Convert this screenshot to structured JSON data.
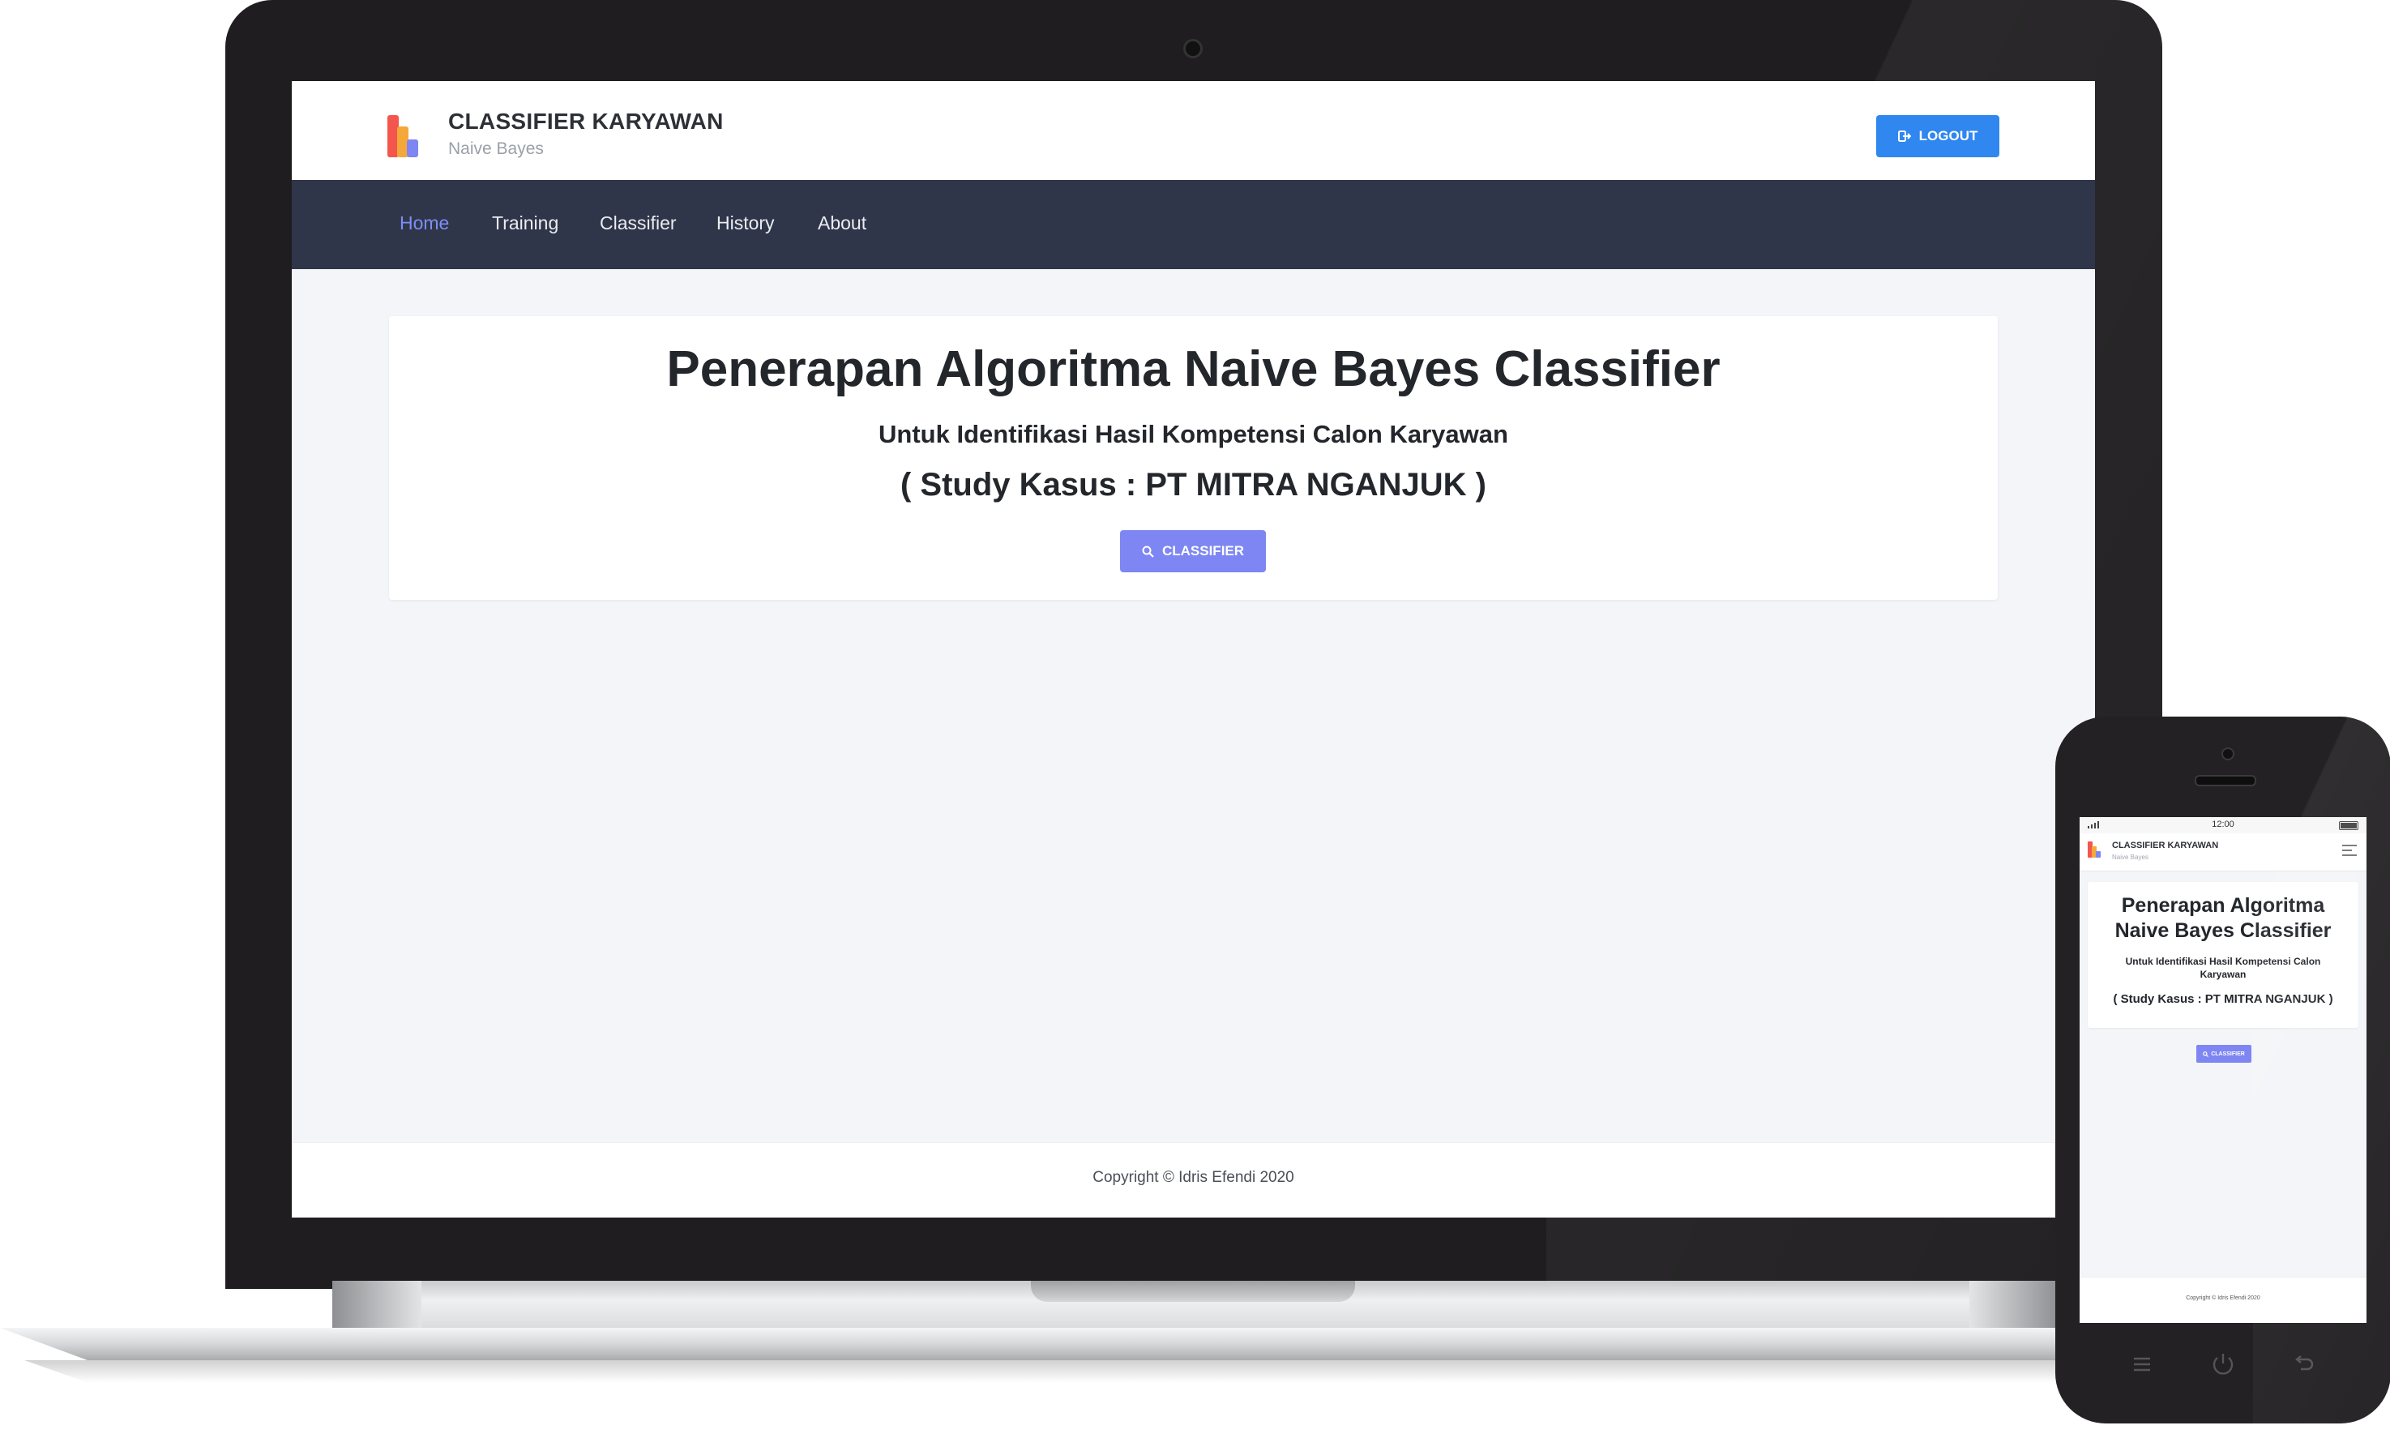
{
  "app": {
    "brand_title": "CLASSIFIER KARYAWAN",
    "brand_subtitle": "Naive Bayes",
    "logout_label": "LOGOUT",
    "nav": [
      {
        "label": "Home",
        "active": true
      },
      {
        "label": "Training",
        "active": false
      },
      {
        "label": "Classifier",
        "active": false
      },
      {
        "label": "History",
        "active": false
      },
      {
        "label": "About",
        "active": false
      }
    ],
    "hero": {
      "title": "Penerapan Algoritma Naive Bayes Classifier",
      "title_line1": "Penerapan Algoritma",
      "title_line2": "Naive Bayes Classifier",
      "subtitle": "Untuk Identifikasi Hasil Kompetensi Calon Karyawan",
      "subtitle_line1": "Untuk Identifikasi Hasil Kompetensi Calon",
      "subtitle_line2": "Karyawan",
      "case_study": "( Study Kasus : PT MITRA NGANJUK )",
      "button_label": "CLASSIFIER"
    },
    "footer": "Copyright © Idris Efendi 2020"
  },
  "phone_status": {
    "time": "12:00"
  },
  "colors": {
    "primary_blue": "#2f87ef",
    "accent_purple": "#7d86f2",
    "navbar_bg": "#2f3649",
    "nav_active": "#7d8ef6"
  },
  "icons": [
    "logout-icon",
    "search-icon",
    "menu-icon",
    "power-icon",
    "back-icon"
  ]
}
